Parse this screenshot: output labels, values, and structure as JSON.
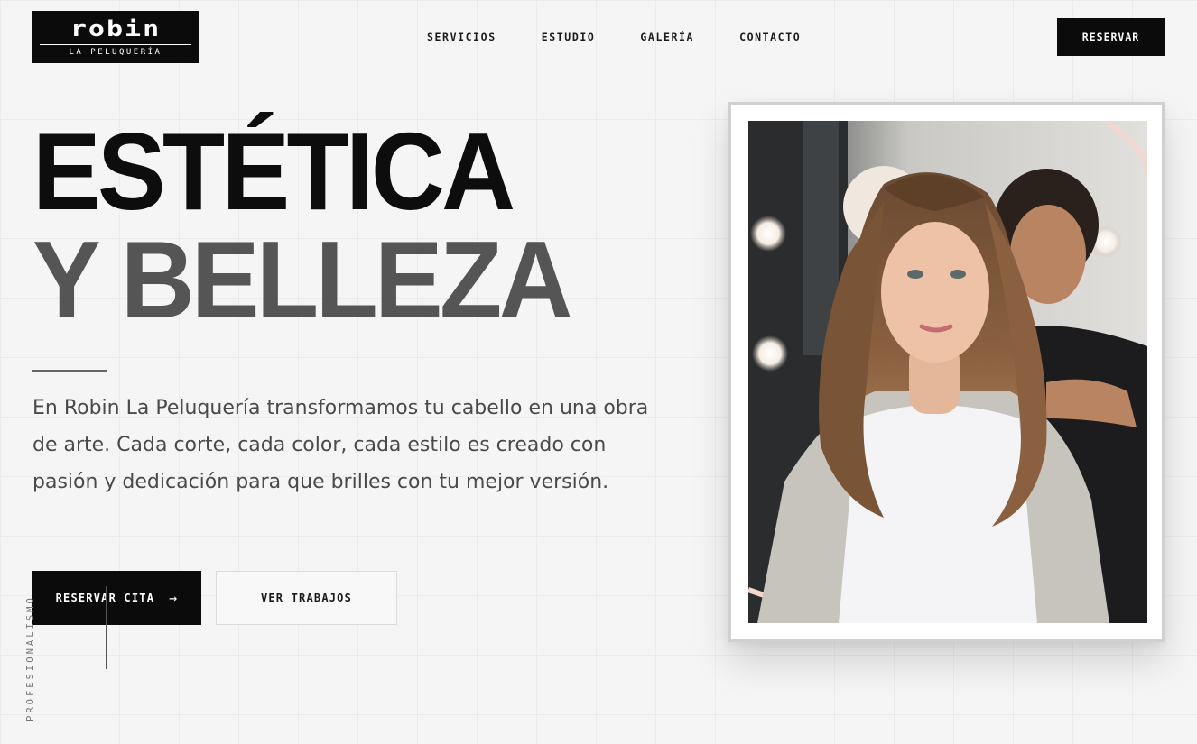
{
  "header": {
    "logo": {
      "name": "robin",
      "tagline": "LA PELUQUERÍA"
    },
    "nav": [
      "SERVICIOS",
      "ESTUDIO",
      "GALERÍA",
      "CONTACTO"
    ],
    "cta_label": "RESERVAR"
  },
  "hero": {
    "title_line1": "ESTÉTICA",
    "title_line2": "Y BELLEZA",
    "description": "En Robin La Peluquería transformamos tu cabello en una obra de arte. Cada corte, cada color, cada estilo es creado con pasión y dedicación para que brilles con tu mejor versión.",
    "primary_button": {
      "label": "RESERVAR CITA",
      "icon": "arrow-right-icon",
      "icon_glyph": "→"
    },
    "secondary_button": {
      "label": "VER TRABAJOS"
    },
    "side_label": "PROFESIONALISMO"
  },
  "photo": {
    "subject": "stylist-with-client-photo"
  },
  "colors": {
    "background": "#f5f5f5",
    "black": "#0b0b0b",
    "title_dark": "#0d0d0d",
    "title_gray": "#555555",
    "body_text": "#4a4a4a"
  }
}
